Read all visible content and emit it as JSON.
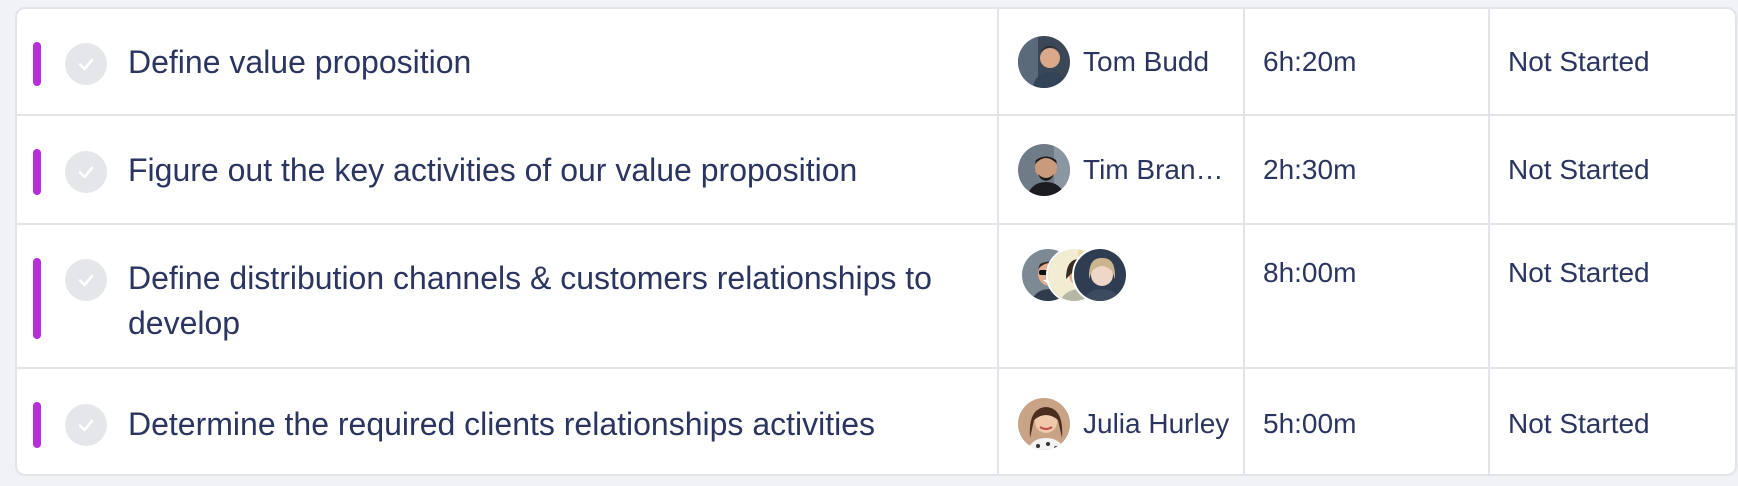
{
  "colors": {
    "accent_bar": "#b62ed8",
    "check_bg": "#e4e6ea",
    "text": "#2b3560",
    "border": "#e2e4ea"
  },
  "rows": [
    {
      "task": "Define value proposition",
      "assignee": "Tom Budd",
      "time": "6h:20m",
      "status": "Not Started"
    },
    {
      "task": "Figure out the key activities of our value proposition",
      "assignee": "Tim Bran…",
      "time": "2h:30m",
      "status": "Not Started"
    },
    {
      "task": "Define distribution channels & customers relationships to develop",
      "assignee": "",
      "time": "8h:00m",
      "status": "Not Started"
    },
    {
      "task": "Determine the required clients relationships activities",
      "assignee": "Julia Hurley",
      "time": "5h:00m",
      "status": "Not Started"
    }
  ],
  "icons": {
    "check": "check-icon",
    "avatar": "avatar-photo"
  }
}
